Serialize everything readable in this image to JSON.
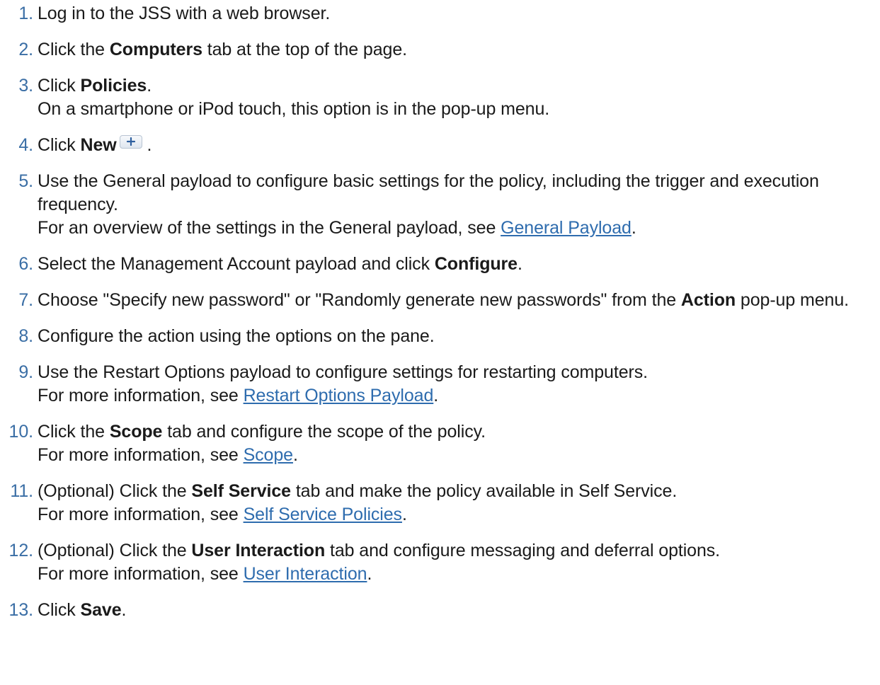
{
  "steps": [
    {
      "num": "1",
      "pre": "Log in to the JSS with a web browser."
    },
    {
      "num": "2",
      "pre": "Click the ",
      "bold": "Computers",
      "post": " tab at the top of the page."
    },
    {
      "num": "3",
      "pre": "Click ",
      "bold": "Policies",
      "post": ".",
      "note": "On a smartphone or iPod touch, this option is in the pop-up menu."
    },
    {
      "num": "4",
      "pre": "Click ",
      "bold": "New",
      "post": " .",
      "icon": "plus-button-icon"
    },
    {
      "num": "5",
      "pre": "Use the General payload to configure basic settings for the policy, including the trigger and execution frequency.",
      "note_pre": "For an overview of the settings in the General payload, see ",
      "link": "General Payload",
      "note_post": "."
    },
    {
      "num": "6",
      "pre": "Select the Management Account payload and click ",
      "bold": "Configure",
      "post": "."
    },
    {
      "num": "7",
      "pre": "Choose \"Specify new password\" or \"Randomly generate new passwords\" from the ",
      "bold": "Action",
      "post": " pop-up menu."
    },
    {
      "num": "8",
      "pre": "Configure the action using the options on the pane."
    },
    {
      "num": "9",
      "pre": "Use the Restart Options payload to configure settings for restarting computers.",
      "note_pre": "For more information, see ",
      "link": "Restart Options Payload",
      "note_post": "."
    },
    {
      "num": "10",
      "pre": "Click the ",
      "bold": "Scope",
      "post": " tab and configure the scope of the policy.",
      "note_pre": "For more information, see ",
      "link": "Scope",
      "note_post": "."
    },
    {
      "num": "11",
      "pre": "(Optional) Click the ",
      "bold": "Self Service",
      "post": " tab and make the policy available in Self Service.",
      "note_pre": "For more information, see ",
      "link": "Self Service Policies",
      "note_post": "."
    },
    {
      "num": "12",
      "pre": "(Optional) Click the ",
      "bold": "User Interaction",
      "post": " tab and configure messaging and deferral options.",
      "note_pre": "For more information, see ",
      "link": "User Interaction",
      "note_post": "."
    },
    {
      "num": "13",
      "pre": "Click ",
      "bold": "Save",
      "post": "."
    }
  ],
  "colors": {
    "step_number": "#3a6ea5",
    "link": "#2e6cae",
    "text": "#1a1a1a"
  }
}
